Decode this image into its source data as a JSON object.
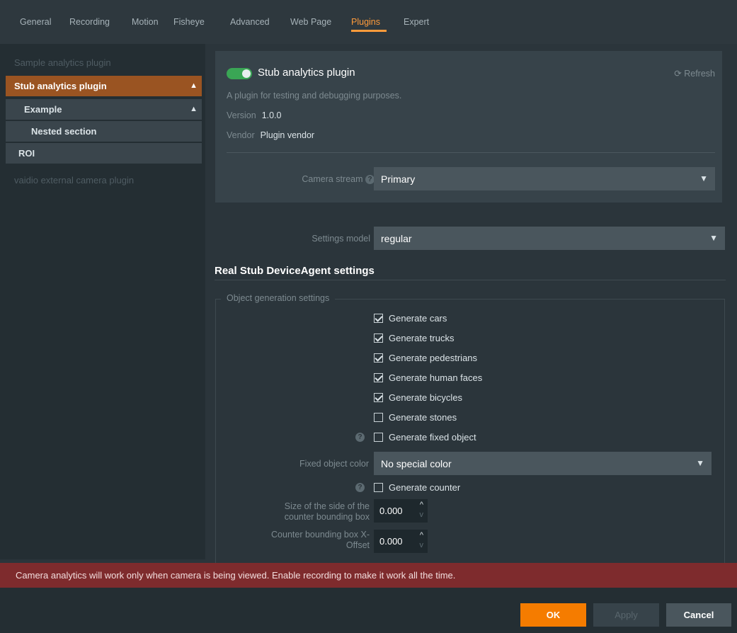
{
  "tabs": [
    {
      "label": "General"
    },
    {
      "label": "Recording"
    },
    {
      "label": "Motion"
    },
    {
      "label": "Fisheye"
    },
    {
      "label": "Advanced"
    },
    {
      "label": "Web Page"
    },
    {
      "label": "Plugins",
      "active": true
    },
    {
      "label": "Expert"
    }
  ],
  "sidebar": {
    "items": [
      {
        "label": "Sample analytics plugin"
      },
      {
        "label": "Stub analytics plugin"
      },
      {
        "label": "Example"
      },
      {
        "label": "Nested section"
      },
      {
        "label": "ROI"
      },
      {
        "label": "vaidio external camera plugin"
      }
    ]
  },
  "plugin": {
    "enabled": true,
    "title": "Stub analytics plugin",
    "refresh_label": "Refresh",
    "description": "A plugin for testing and debugging purposes.",
    "version_key": "Version",
    "version_value": "1.0.0",
    "vendor_key": "Vendor",
    "vendor_value": "Plugin vendor"
  },
  "camera_stream": {
    "label": "Camera stream",
    "value": "Primary"
  },
  "settings_model": {
    "label": "Settings model",
    "value": "regular"
  },
  "section": {
    "title": "Real Stub DeviceAgent settings",
    "group_legend": "Object generation settings"
  },
  "checkboxes": [
    {
      "label": "Generate cars",
      "checked": true
    },
    {
      "label": "Generate trucks",
      "checked": true
    },
    {
      "label": "Generate pedestrians",
      "checked": true
    },
    {
      "label": "Generate human faces",
      "checked": true
    },
    {
      "label": "Generate bicycles",
      "checked": true
    },
    {
      "label": "Generate stones",
      "checked": false
    },
    {
      "label": "Generate fixed object",
      "checked": false
    }
  ],
  "fixed_object_color": {
    "label": "Fixed object color",
    "value": "No special color"
  },
  "generate_counter": {
    "label": "Generate counter",
    "checked": false
  },
  "counter_size": {
    "label_line1": "Size of the side of the",
    "label_line2": "counter bounding box",
    "value": "0.000"
  },
  "counter_x_offset": {
    "label_line1": "Counter bounding box X-",
    "label_line2": "Offset",
    "value": "0.000"
  },
  "alert": {
    "text": "Camera analytics will work only when camera is being viewed. Enable recording to make it work all the time."
  },
  "footer": {
    "ok": "OK",
    "apply": "Apply",
    "cancel": "Cancel"
  },
  "colors": {
    "accent": "#ff9b3b",
    "ok_button": "#f57c00",
    "toggle_on": "#3aa655",
    "alert_bg": "#7e2b2d",
    "selected_item": "#9a5422"
  }
}
